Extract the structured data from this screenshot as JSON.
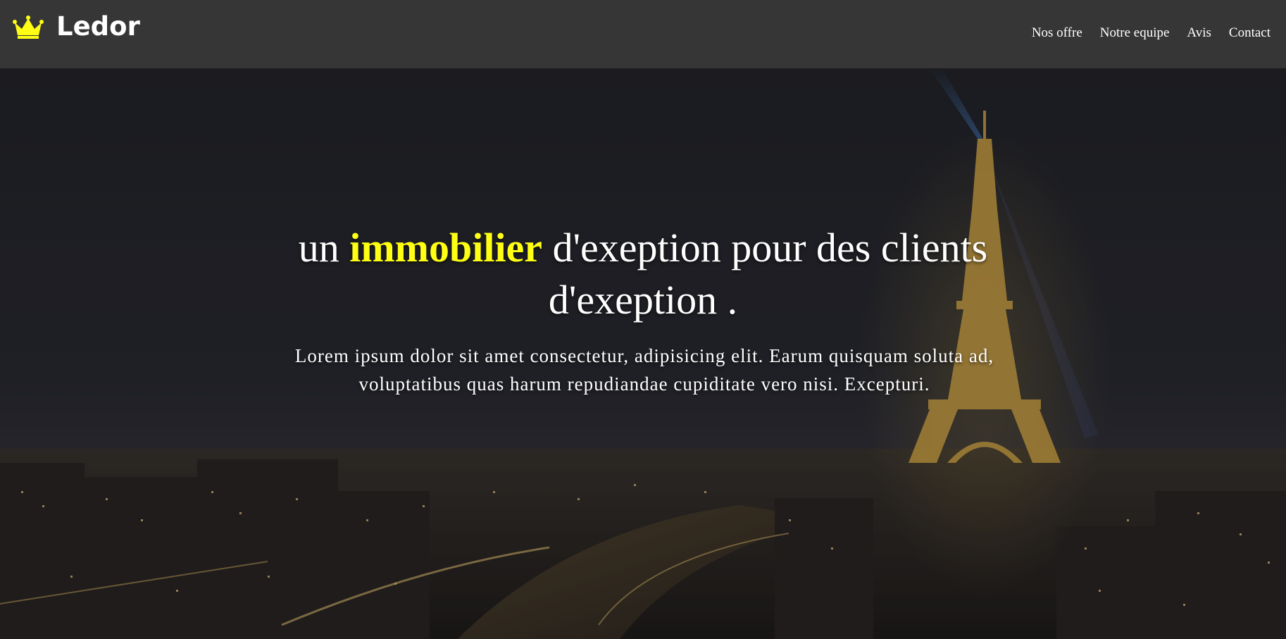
{
  "brand": {
    "logo_icon": "crown-icon",
    "name": "Ledor",
    "accent_color": "#ffff14"
  },
  "nav": {
    "items": [
      {
        "label": "Nos offre"
      },
      {
        "label": "Notre equipe"
      },
      {
        "label": "Avis"
      },
      {
        "label": "Contact"
      }
    ]
  },
  "hero": {
    "background": "Paris night skyline with illuminated Eiffel Tower",
    "headline_before": "un ",
    "headline_highlight": "immobilier",
    "headline_after": " d'exeption pour des clients d'exeption .",
    "lead": "Lorem ipsum dolor sit amet consectetur, adipisicing elit. Earum quisquam soluta ad, voluptatibus quas harum repudiandae cupiditate vero nisi. Excepturi."
  }
}
